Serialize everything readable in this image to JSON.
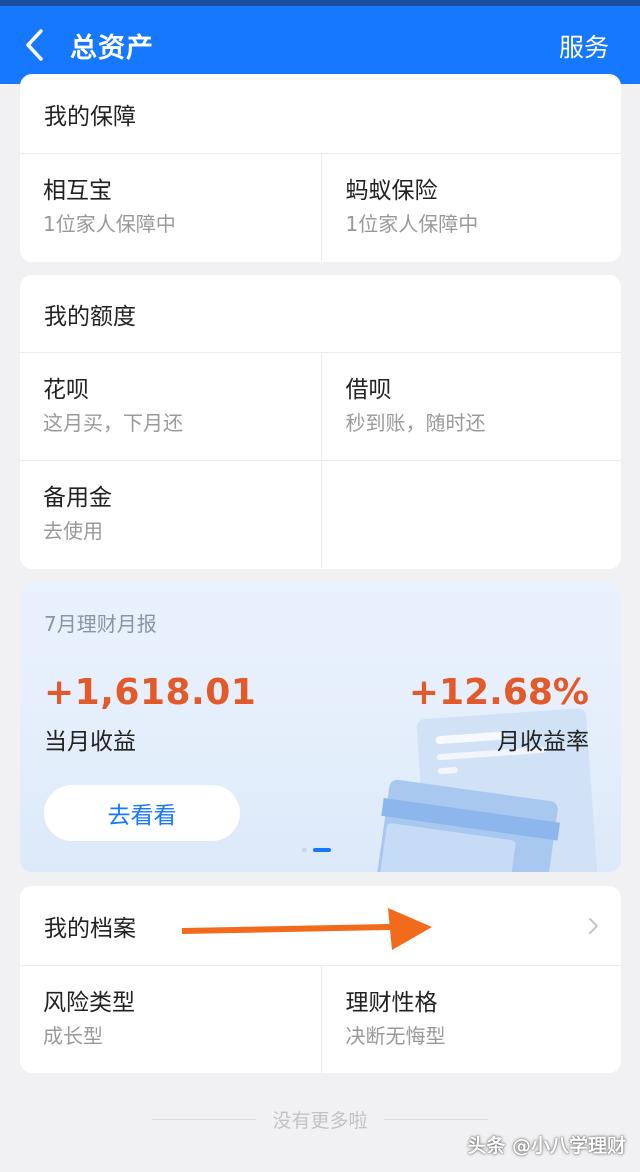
{
  "header": {
    "title": "总资产",
    "service_label": "服务"
  },
  "insurance": {
    "title": "我的保障",
    "items": [
      {
        "main": "相互宝",
        "sub": "1位家人保障中"
      },
      {
        "main": "蚂蚁保险",
        "sub": "1位家人保障中"
      }
    ]
  },
  "credit": {
    "title": "我的额度",
    "items": [
      {
        "main": "花呗",
        "sub": "这月买，下月还"
      },
      {
        "main": "借呗",
        "sub": "秒到账，随时还"
      },
      {
        "main": "备用金",
        "sub": "去使用"
      }
    ]
  },
  "report": {
    "title": "7月理财月报",
    "income_amount": "+1,618.01",
    "income_label": "当月收益",
    "rate_value": "+12.68%",
    "rate_label": "月收益率",
    "button_label": "去看看",
    "carousel": {
      "count": 2,
      "active_index": 1
    }
  },
  "profile": {
    "title": "我的档案",
    "items": [
      {
        "main": "风险类型",
        "sub": "成长型"
      },
      {
        "main": "理财性格",
        "sub": "决断无悔型"
      }
    ]
  },
  "footer": {
    "no_more_text": "没有更多啦"
  },
  "watermark": {
    "text": "头条 @小八学理财"
  },
  "colors": {
    "header_bg": "#1677ff",
    "accent_orange": "#e2592a",
    "arrow_orange": "#f26a1b",
    "link_blue": "#1677ff"
  }
}
